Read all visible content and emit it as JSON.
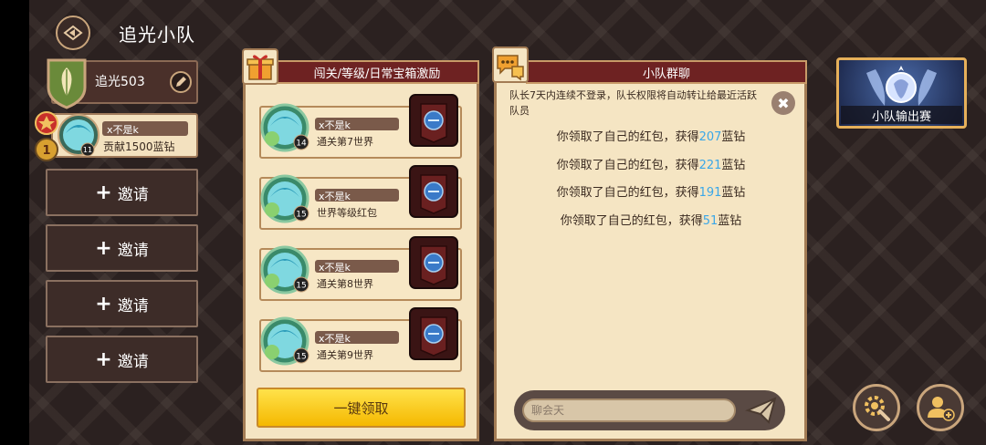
{
  "header": {
    "title": "追光小队"
  },
  "team": {
    "name": "追光503"
  },
  "member": {
    "name": "x不是k",
    "contribution": "贡献1500蓝钻",
    "level": "11",
    "rank": "1"
  },
  "invite_buttons": [
    {
      "plus": "+",
      "label": "邀请"
    },
    {
      "plus": "+",
      "label": "邀请"
    },
    {
      "plus": "+",
      "label": "邀请"
    },
    {
      "plus": "+",
      "label": "邀请"
    }
  ],
  "rewards_panel": {
    "title": "闯关/等级/日常宝箱激励",
    "items": [
      {
        "name": "x不是k",
        "level": "14",
        "desc": "通关第7世界"
      },
      {
        "name": "x不是k",
        "level": "15",
        "desc": "世界等级红包"
      },
      {
        "name": "x不是k",
        "level": "15",
        "desc": "通关第8世界"
      },
      {
        "name": "x不是k",
        "level": "15",
        "desc": "通关第9世界"
      }
    ],
    "claim_all_label": "一键领取"
  },
  "chat_panel": {
    "title": "小队群聊",
    "notice": "队长7天内连续不登录，队长权限将自动转让给最近活跃队员",
    "messages": [
      {
        "prefix": "你领取了自己的红包，获得",
        "amount": "207",
        "suffix": "蓝钻"
      },
      {
        "prefix": "你领取了自己的红包，获得",
        "amount": "221",
        "suffix": "蓝钻"
      },
      {
        "prefix": "你领取了自己的红包，获得",
        "amount": "191",
        "suffix": "蓝钻"
      },
      {
        "prefix": "你领取了自己的红包，获得",
        "amount": "51",
        "suffix": "蓝钻"
      }
    ],
    "input_placeholder": "聊会天"
  },
  "event": {
    "label": "小队输出赛"
  },
  "icons": [
    "back-icon",
    "leaf-shield-icon",
    "edit-icon",
    "gift-icon",
    "chat-bubble-icon",
    "chest-icon",
    "close-icon",
    "send-icon",
    "settings-gear-icon",
    "add-member-icon"
  ],
  "colors": {
    "header_red": "#6e2222",
    "amount_blue": "#3aa7e8",
    "claim_yellow": "#f5b800"
  }
}
